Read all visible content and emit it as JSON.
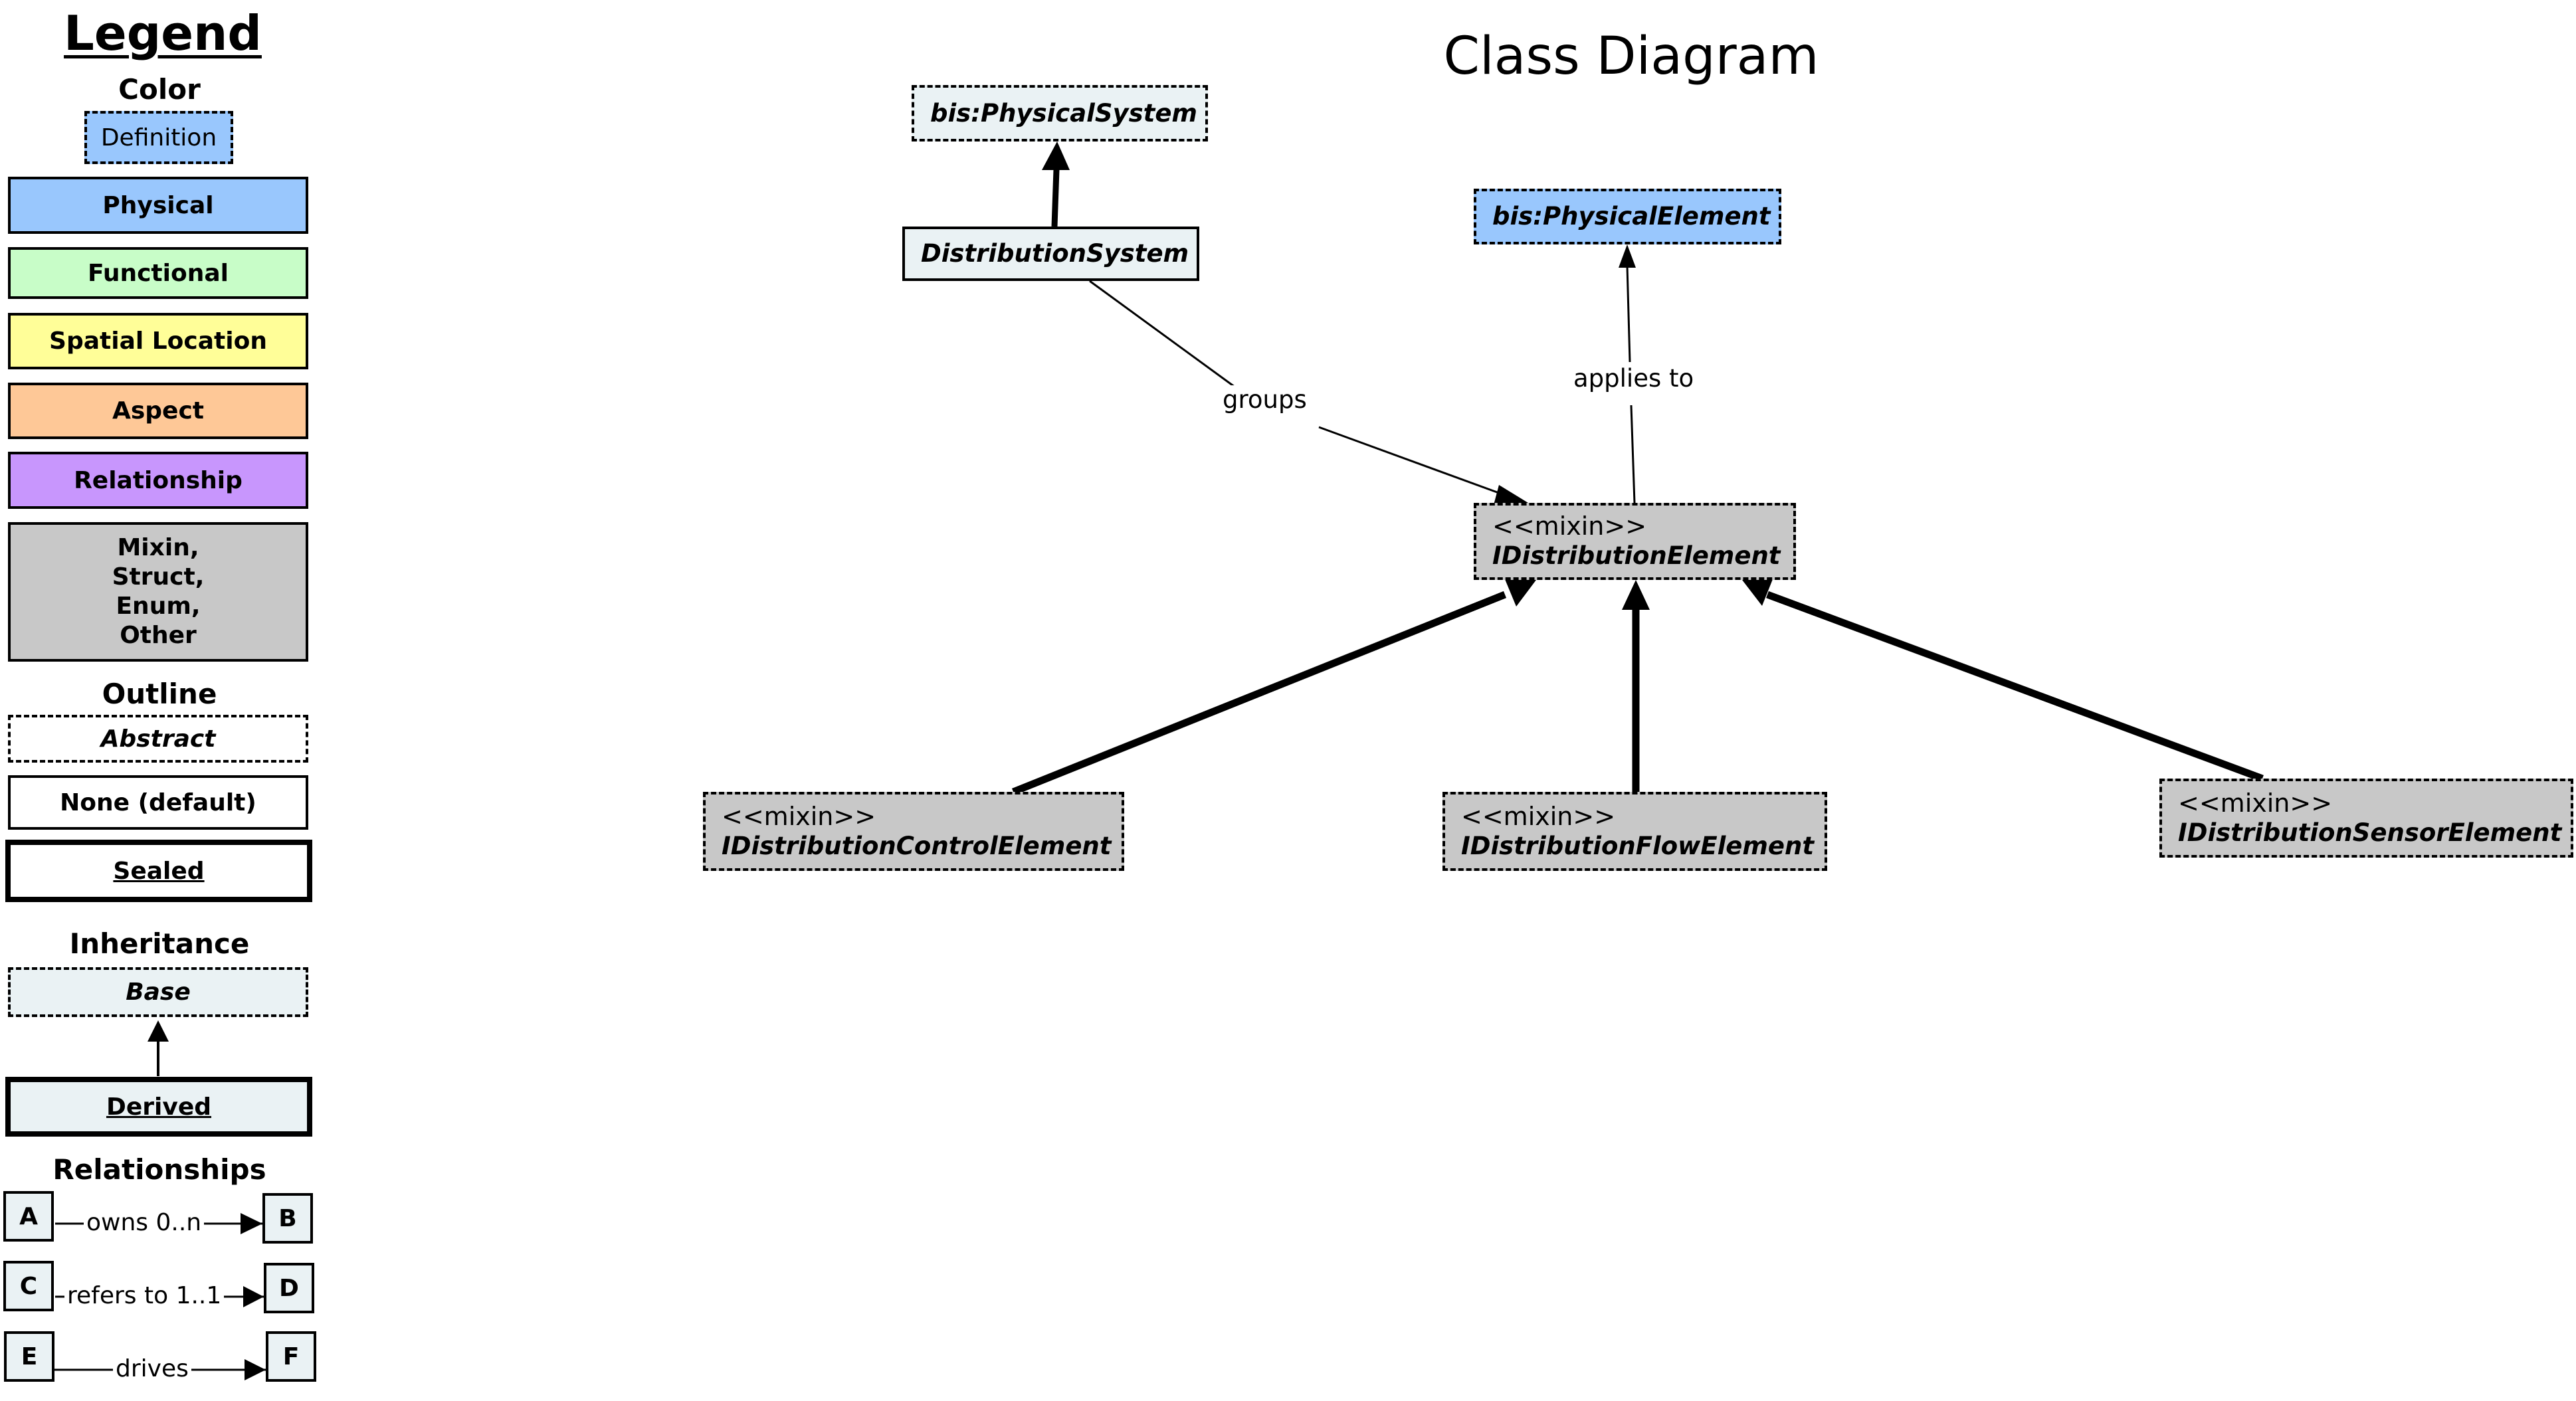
{
  "legend": {
    "title": "Legend",
    "color_heading": "Color",
    "definition_label": "Definition",
    "colors": [
      {
        "label": "Physical",
        "fill": "#99c7fd"
      },
      {
        "label": "Functional",
        "fill": "#c8fdc8"
      },
      {
        "label": "Spatial Location",
        "fill": "#fffe98"
      },
      {
        "label": "Aspect",
        "fill": "#fec897"
      },
      {
        "label": "Relationship",
        "fill": "#c896fd"
      },
      {
        "label": "Mixin,\nStruct,\nEnum,\nOther",
        "fill": "#c8c8c8"
      }
    ],
    "definition_fill": "#99c7fd",
    "outline_heading": "Outline",
    "outlines": {
      "abstract": "Abstract",
      "none": "None (default)",
      "sealed": "Sealed"
    },
    "inheritance_heading": "Inheritance",
    "inheritance": {
      "base": "Base",
      "derived": "Derived"
    },
    "relationships_heading": "Relationships",
    "relationships": [
      {
        "from": "A",
        "label": "owns 0..n",
        "to": "B"
      },
      {
        "from": "C",
        "label": "refers to 1..1",
        "to": "D"
      },
      {
        "from": "E",
        "label": "drives",
        "to": "F"
      }
    ]
  },
  "diagram": {
    "title": "Class Diagram",
    "nodes": {
      "physical_system": {
        "name": "bis:PhysicalSystem",
        "stereotype": null
      },
      "distribution_system": {
        "name": "DistributionSystem",
        "stereotype": null
      },
      "physical_element": {
        "name": "bis:PhysicalElement",
        "stereotype": null
      },
      "distribution_element": {
        "name": "IDistributionElement",
        "stereotype": "<<mixin>>"
      },
      "control_element": {
        "name": "IDistributionControlElement",
        "stereotype": "<<mixin>>"
      },
      "flow_element": {
        "name": "IDistributionFlowElement",
        "stereotype": "<<mixin>>"
      },
      "sensor_element": {
        "name": "IDistributionSensorElement",
        "stereotype": "<<mixin>>"
      }
    },
    "edges": [
      {
        "from": "DistributionSystem",
        "to": "bis:PhysicalSystem",
        "kind": "inheritance",
        "label": ""
      },
      {
        "from": "DistributionSystem",
        "to": "IDistributionElement",
        "kind": "relationship",
        "label": "groups"
      },
      {
        "from": "IDistributionElement",
        "to": "bis:PhysicalElement",
        "kind": "relationship",
        "label": "applies to"
      },
      {
        "from": "IDistributionControlElement",
        "to": "IDistributionElement",
        "kind": "inheritance",
        "label": ""
      },
      {
        "from": "IDistributionFlowElement",
        "to": "IDistributionElement",
        "kind": "inheritance",
        "label": ""
      },
      {
        "from": "IDistributionSensorElement",
        "to": "IDistributionElement",
        "kind": "inheritance",
        "label": ""
      }
    ],
    "labels": {
      "groups": "groups",
      "applies_to": "applies to"
    },
    "colors": {
      "base_fill": "#eaf2f4",
      "physical_fill": "#99c7fd",
      "mixin_fill": "#c8c8c8"
    }
  }
}
